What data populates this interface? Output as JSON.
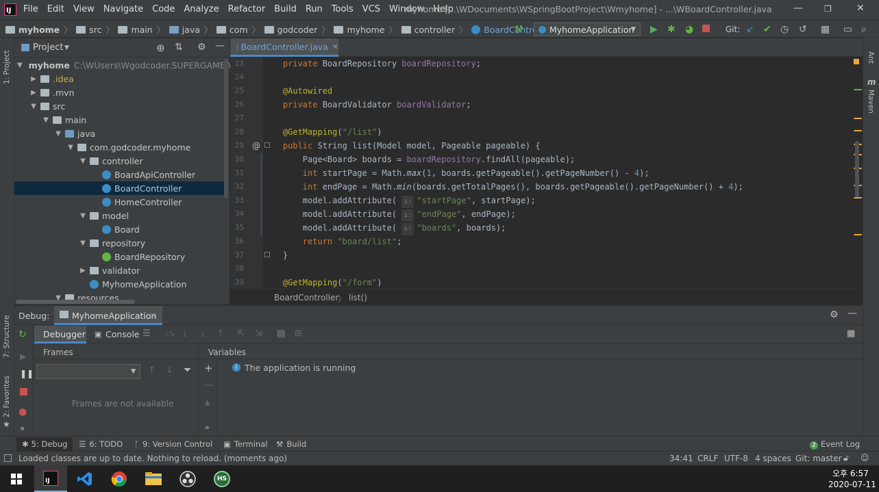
{
  "app": {
    "logo": "IJ",
    "menu": [
      "File",
      "Edit",
      "View",
      "Navigate",
      "Code",
      "Analyze",
      "Refactor",
      "Build",
      "Run",
      "Tools",
      "VCS",
      "Window",
      "Help"
    ],
    "title": "myhome [...\\WDocuments\\WSpringBootProject\\Wmyhome] - ...\\WBoardController.java"
  },
  "navbar": {
    "crumbs": [
      "myhome",
      "src",
      "main",
      "java",
      "com",
      "godcoder",
      "myhome",
      "controller",
      "BoardController"
    ],
    "run_config": "MyhomeApplication",
    "git_label": "Git:"
  },
  "left_stripe": {
    "project": "1: Project",
    "structure": "7: Structure",
    "favorites": "2: Favorites"
  },
  "right_stripe": {
    "ant": "Ant",
    "maven": "Maven"
  },
  "project": {
    "header": "Project",
    "tree": [
      {
        "label": "myhome",
        "path": "C:\\WUsers\\Wgodcoder.SUPERGAME\\WDoc",
        "depth": 0,
        "arrow": "▼",
        "icon": "folder",
        "bold": true
      },
      {
        "label": ".idea",
        "depth": 1,
        "arrow": "▶",
        "icon": "folder",
        "yellow": true
      },
      {
        "label": ".mvn",
        "depth": 1,
        "arrow": "▶",
        "icon": "folder"
      },
      {
        "label": "src",
        "depth": 1,
        "arrow": "▼",
        "icon": "folder"
      },
      {
        "label": "main",
        "depth": 2,
        "arrow": "▼",
        "icon": "folder"
      },
      {
        "label": "java",
        "depth": 3,
        "arrow": "▼",
        "icon": "folder-blue"
      },
      {
        "label": "com.godcoder.myhome",
        "depth": 4,
        "arrow": "▼",
        "icon": "folder"
      },
      {
        "label": "controller",
        "depth": 5,
        "arrow": "▼",
        "icon": "folder"
      },
      {
        "label": "BoardApiController",
        "depth": 6,
        "arrow": "",
        "icon": "class"
      },
      {
        "label": "BoardController",
        "depth": 6,
        "arrow": "",
        "icon": "class",
        "selected": true
      },
      {
        "label": "HomeController",
        "depth": 6,
        "arrow": "",
        "icon": "class"
      },
      {
        "label": "model",
        "depth": 5,
        "arrow": "▼",
        "icon": "folder"
      },
      {
        "label": "Board",
        "depth": 6,
        "arrow": "",
        "icon": "class"
      },
      {
        "label": "repository",
        "depth": 5,
        "arrow": "▼",
        "icon": "folder"
      },
      {
        "label": "BoardRepository",
        "depth": 6,
        "arrow": "",
        "icon": "interface"
      },
      {
        "label": "validator",
        "depth": 5,
        "arrow": "▶",
        "icon": "folder"
      },
      {
        "label": "MyhomeApplication",
        "depth": 5,
        "arrow": "",
        "icon": "class"
      },
      {
        "label": "resources",
        "depth": 3,
        "arrow": "▼",
        "icon": "folder"
      }
    ]
  },
  "editor": {
    "tab": "BoardController.java",
    "lines": [
      {
        "n": "23",
        "html": "    <span class='kw'>private</span> BoardRepository <span class='fld'>boardRepository</span>;"
      },
      {
        "n": "24",
        "html": ""
      },
      {
        "n": "25",
        "html": "    <span class='ann'>@Autowired</span>"
      },
      {
        "n": "26",
        "html": "    <span class='kw'>private</span> BoardValidator <span class='fld'>boardValidator</span>;"
      },
      {
        "n": "27",
        "html": ""
      },
      {
        "n": "28",
        "html": "    <span class='ann'>@GetMapping</span>(<span class='str'>\"/list\"</span>)"
      },
      {
        "n": "29",
        "html": "    <span class='kw'>public</span> String list(Model model, Pageable pageable) {"
      },
      {
        "n": "30",
        "html": "        Page&lt;Board&gt; boards = <span class='fld'>boardRepository</span>.findAll(pageable);"
      },
      {
        "n": "31",
        "html": "        <span class='kw'>int</span> startPage = Math.<span class='ital'>max</span>(<span class='num'>1</span>, boards.getPageable().getPageNumber() - <span class='num'>4</span>);"
      },
      {
        "n": "32",
        "html": "        <span class='kw'>int</span> endPage = Math.<span class='ital'>min</span>(boards.getTotalPages(), boards.getPageable().getPageNumber() + <span class='num'>4</span>);"
      },
      {
        "n": "33",
        "html": "        model.addAttribute( <span class='hint'>s:</span><span class='str'>\"startPage\"</span>, startPage);"
      },
      {
        "n": "34",
        "html": "        model.addAttribute( <span class='hint'>s:</span><span class='str'>\"endPage\"</span>, endPage);"
      },
      {
        "n": "35",
        "html": "        model.addAttribute( <span class='hint'>s:</span><span class='str'>\"boards\"</span>, boards);"
      },
      {
        "n": "36",
        "html": "        <span class='kw'>return</span> <span class='str'>\"board/list\"</span>;"
      },
      {
        "n": "37",
        "html": "    }"
      },
      {
        "n": "38",
        "html": ""
      },
      {
        "n": "39",
        "html": "    <span class='ann'>@GetMapping</span>(<span class='str'>\"/form\"</span>)"
      }
    ],
    "breadcrumb": [
      "BoardController",
      "list()"
    ]
  },
  "debug": {
    "label": "Debug:",
    "session": "MyhomeApplication",
    "tabs": [
      "Debugger",
      "Console"
    ],
    "frames_header": "Frames",
    "frames_empty": "Frames are not available",
    "variables_header": "Variables",
    "variables_message": "The application is running"
  },
  "bottombar": {
    "items": [
      "5: Debug",
      "6: TODO",
      "9: Version Control",
      "Terminal",
      "Build"
    ],
    "event_log": "Event Log",
    "event_count": "2"
  },
  "status": {
    "message": "Loaded classes are up to date. Nothing to reload. (moments ago)",
    "position": "34:41",
    "line_sep": "CRLF",
    "encoding": "UTF-8",
    "indent": "4 spaces",
    "git_branch": "Git: master"
  },
  "taskbar": {
    "time": "오후 6:57",
    "date": "2020-07-11",
    "hs_label": "HS"
  },
  "colors": {
    "accent": "#4a88c7",
    "keyword": "#cc7832",
    "string": "#6a8759",
    "field": "#9876aa"
  }
}
